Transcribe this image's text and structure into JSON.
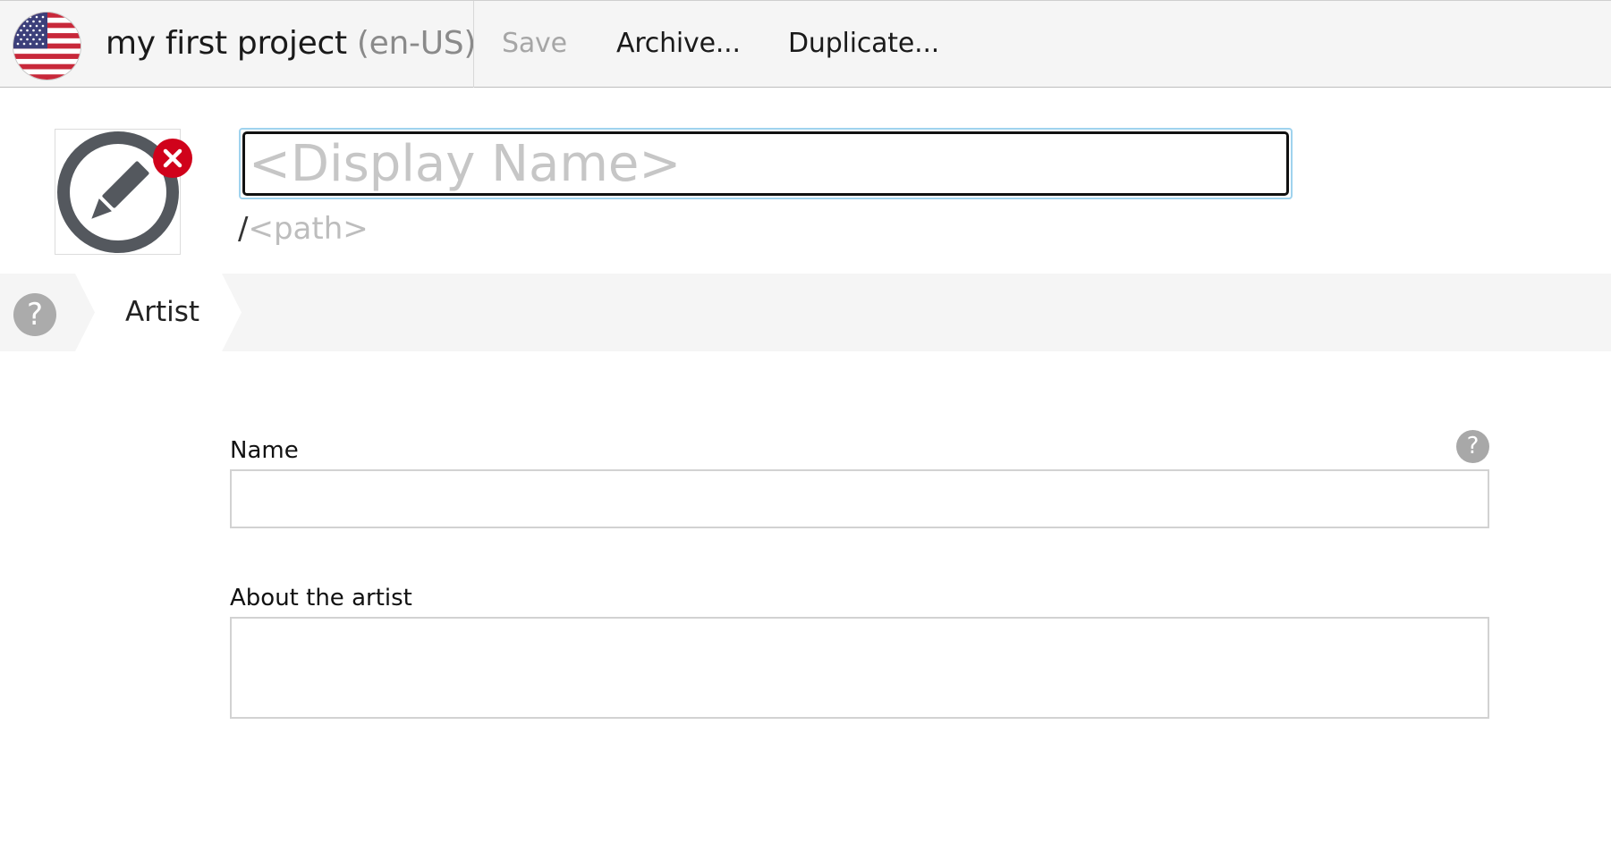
{
  "toolbar": {
    "flag_icon": "us-flag-icon",
    "project_name": "my first project",
    "locale": "(en-US)",
    "save_label": "Save",
    "archive_label": "Archive...",
    "duplicate_label": "Duplicate..."
  },
  "header": {
    "content_icon": "pencil-icon",
    "remove_icon": "remove-icon",
    "display_name": {
      "value": "",
      "placeholder": "<Display Name>"
    },
    "path_prefix": "/",
    "path_placeholder": "<path>"
  },
  "steps": {
    "help_symbol": "?",
    "items": [
      {
        "label": "Artist",
        "active": true
      }
    ]
  },
  "form": {
    "fields": [
      {
        "label": "Name",
        "value": "",
        "type": "text",
        "help_symbol": "?"
      },
      {
        "label": "About the artist",
        "value": "",
        "type": "textarea"
      }
    ]
  },
  "colors": {
    "toolbar_bg": "#f5f5f5",
    "focus_ring": "#9fd3ee",
    "remove_red": "#d0021b",
    "icon_gray": "#54585e",
    "help_gray": "#ababab",
    "placeholder_gray": "#c6c6c6"
  }
}
